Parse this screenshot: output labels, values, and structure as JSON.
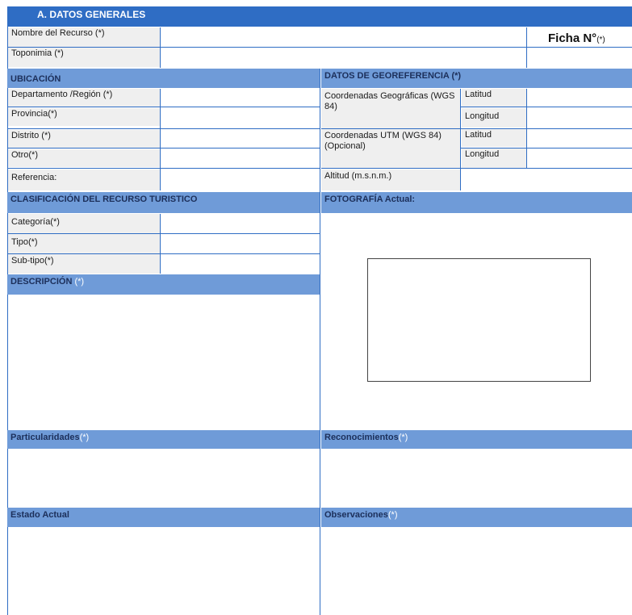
{
  "section_title": "A.  DATOS GENERALES",
  "row1": {
    "nombre_label": "Nombre del Recurso (*)",
    "nombre_value": "",
    "ficha_label": "Ficha N°",
    "ficha_star": "(*)"
  },
  "row2": {
    "toponimia_label": "Toponimia (*)",
    "toponimia_value": ""
  },
  "ubicacion": {
    "header": "UBICACIÓN",
    "fields": [
      {
        "label": "Departamento /Región (*)",
        "value": ""
      },
      {
        "label": "Provincia(*)",
        "value": ""
      },
      {
        "label": "Distrito (*)",
        "value": ""
      },
      {
        "label": "Otro(*)",
        "value": ""
      },
      {
        "label": "Referencia:",
        "value": ""
      }
    ]
  },
  "georef": {
    "header": "DATOS DE GEOREFERENCIA (*)",
    "geo_label": "Coordenadas Geográficas (WGS 84)",
    "utm_label": "Coordenadas UTM (WGS 84) (Opcional)",
    "latitud": "Latitud",
    "longitud": "Longitud",
    "altitud_label": "Altitud (m.s.n.m.)"
  },
  "clasificacion": {
    "header": "CLASIFICACIÓN DEL RECURSO TURISTICO",
    "fields": [
      {
        "label": "Categoría(*)",
        "value": ""
      },
      {
        "label": "Tipo(*)",
        "value": ""
      },
      {
        "label": "Sub-tipo(*)",
        "value": ""
      }
    ]
  },
  "fotografia": {
    "header": "FOTOGRAFÍA Actual:"
  },
  "descripcion": {
    "header": "DESCRIPCIÓN",
    "star": "(*)"
  },
  "particularidades": {
    "header": "Particularidades",
    "star": "(*)"
  },
  "reconocimientos": {
    "header": "Reconocimientos",
    "star": "(*)"
  },
  "estado": {
    "header": "Estado Actual"
  },
  "observaciones": {
    "header": "Observaciones",
    "star": "(*)"
  },
  "colors": {
    "accent": "#2f6dc4",
    "header_fill": "#6f9bd8",
    "label_fill": "#efefef"
  }
}
